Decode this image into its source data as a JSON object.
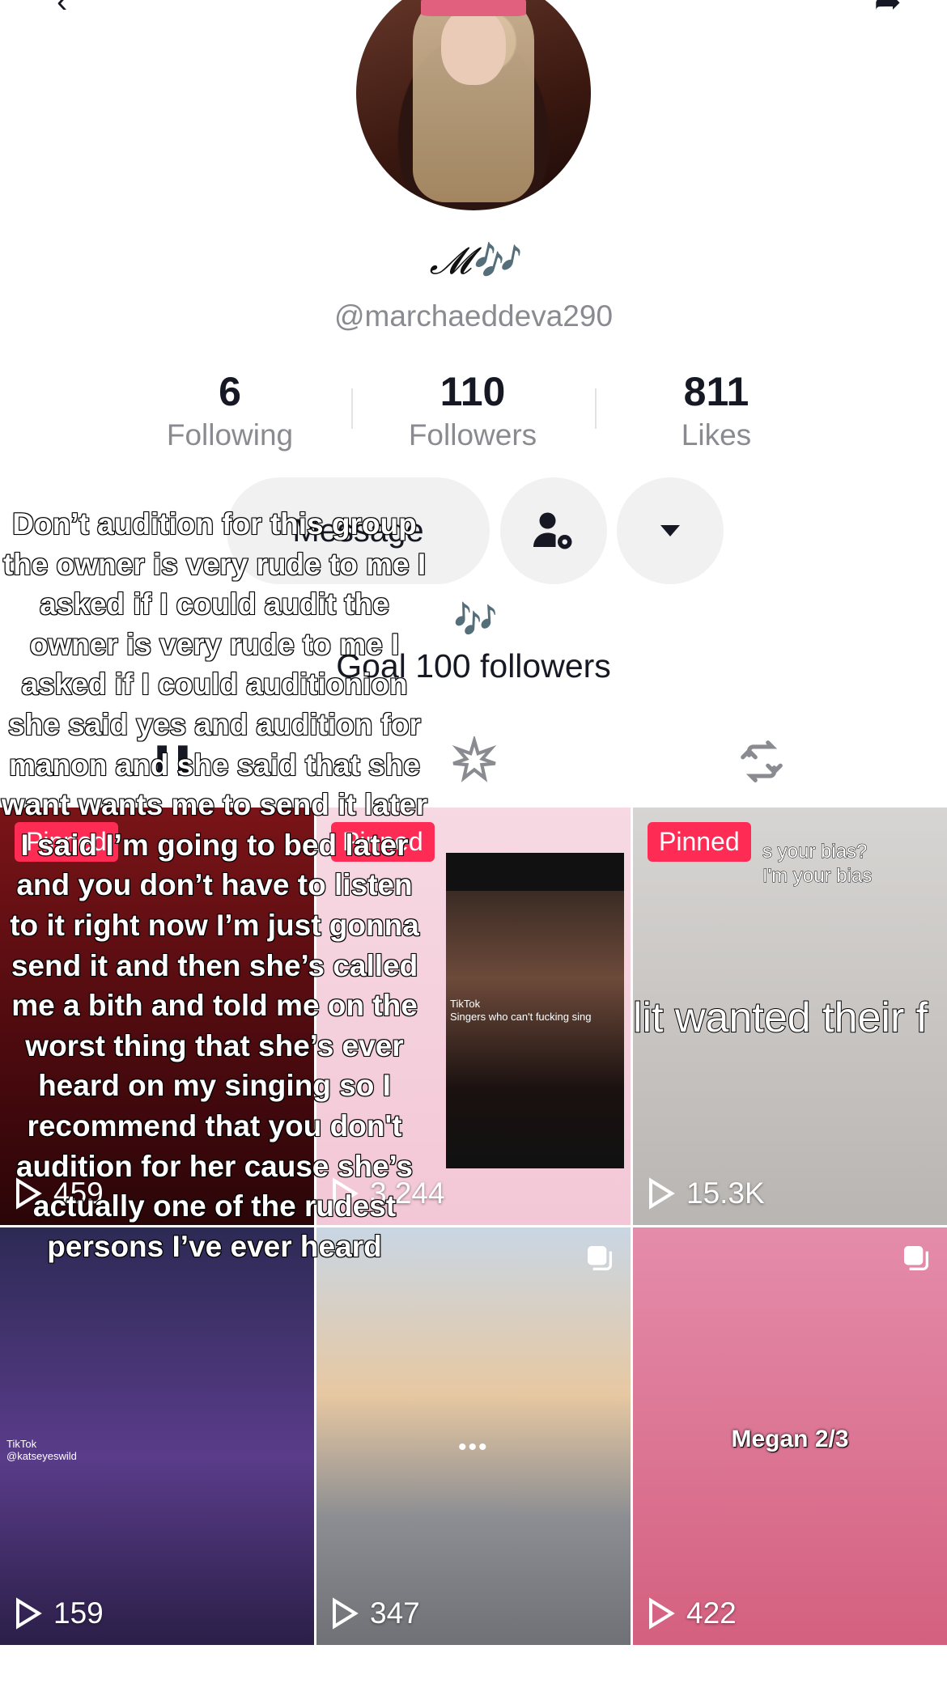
{
  "profile": {
    "display_name": "𝓜🎶",
    "username": "@marchaeddeva290",
    "bio_icon": "🎶",
    "bio_text": "Goal 100 followers"
  },
  "stats": [
    {
      "value": "6",
      "label": "Following"
    },
    {
      "value": "110",
      "label": "Followers"
    },
    {
      "value": "811",
      "label": "Likes"
    }
  ],
  "actions": {
    "message_label": "Message",
    "friend_settings_icon": "person-gear-icon",
    "more_icon": "triangle-down-icon"
  },
  "tabs": {
    "videos_icon": "grid-icon",
    "sparkle_icon": "sparkle-icon",
    "repost_icon": "repost-icon"
  },
  "overlay_text": "Don’t audition for this group the owner is very rude to me I asked if I could audit  the owner is very rude to me I asked if I could auditionion she said yes and audition for manon and she said that she want wants me to send it later I said I’m going to bed later and you don’t have to listen to it right now I’m just gonna send it and then she’s called me a bith and told me on the worst thing that she’s ever heard on my singing so I recommend that you don't audition for her cause she’s actually one of the rudest persons I’ve ever heard",
  "videos": [
    {
      "pinned": "Pinned",
      "views": "459"
    },
    {
      "pinned": "Pinned",
      "views": "3,244",
      "inner_caption": "TikTok\nSingers who can't fucking sing"
    },
    {
      "pinned": "Pinned",
      "views": "15.3K",
      "top_caption": "s your bias?\nI'm your bias",
      "caption": "lit wanted their f"
    },
    {
      "views": "159",
      "watermark": "TikTok @katseyeswild"
    },
    {
      "views": "347",
      "dots": "•••"
    },
    {
      "views": "422",
      "caption": "Megan 2/3"
    }
  ],
  "colors": {
    "pinned_bg": "#fe2c55",
    "muted_text": "#8a8b91",
    "button_bg": "#f1f1f2"
  }
}
